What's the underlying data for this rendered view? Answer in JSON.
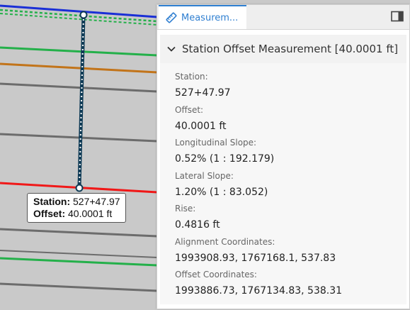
{
  "viewport": {
    "line_colors": {
      "blue": "#1a2fd6",
      "green": "#24b04a",
      "orange": "#c2741a",
      "gray": "#6c6c6c",
      "red": "#f01818",
      "measure": "#0f3b56"
    },
    "tooltip": {
      "station_label": "Station:",
      "station_value": "527+47.97",
      "offset_label": "Offset:",
      "offset_value": "40.0001 ft"
    }
  },
  "panel": {
    "tab": {
      "icon": "ruler-icon",
      "label": "Measurem..."
    },
    "dock_icon": "dock-panel-icon",
    "section": {
      "expand_icon": "chevron-down-icon",
      "title": "Station Offset Measurement [40.0001 ft]"
    },
    "properties": [
      {
        "label": "Station:",
        "value": "527+47.97"
      },
      {
        "label": "Offset:",
        "value": "40.0001 ft"
      },
      {
        "label": "Longitudinal Slope:",
        "value": "0.52% (1 : 192.179)"
      },
      {
        "label": "Lateral Slope:",
        "value": "1.20% (1 : 83.052)"
      },
      {
        "label": "Rise:",
        "value": "0.4816 ft"
      },
      {
        "label": "Alignment Coordinates:",
        "value": "1993908.93, 1767168.1, 537.83"
      },
      {
        "label": "Offset Coordinates:",
        "value": "1993886.73, 1767134.83, 538.31"
      }
    ],
    "accent_color": "#2f7fd1"
  }
}
